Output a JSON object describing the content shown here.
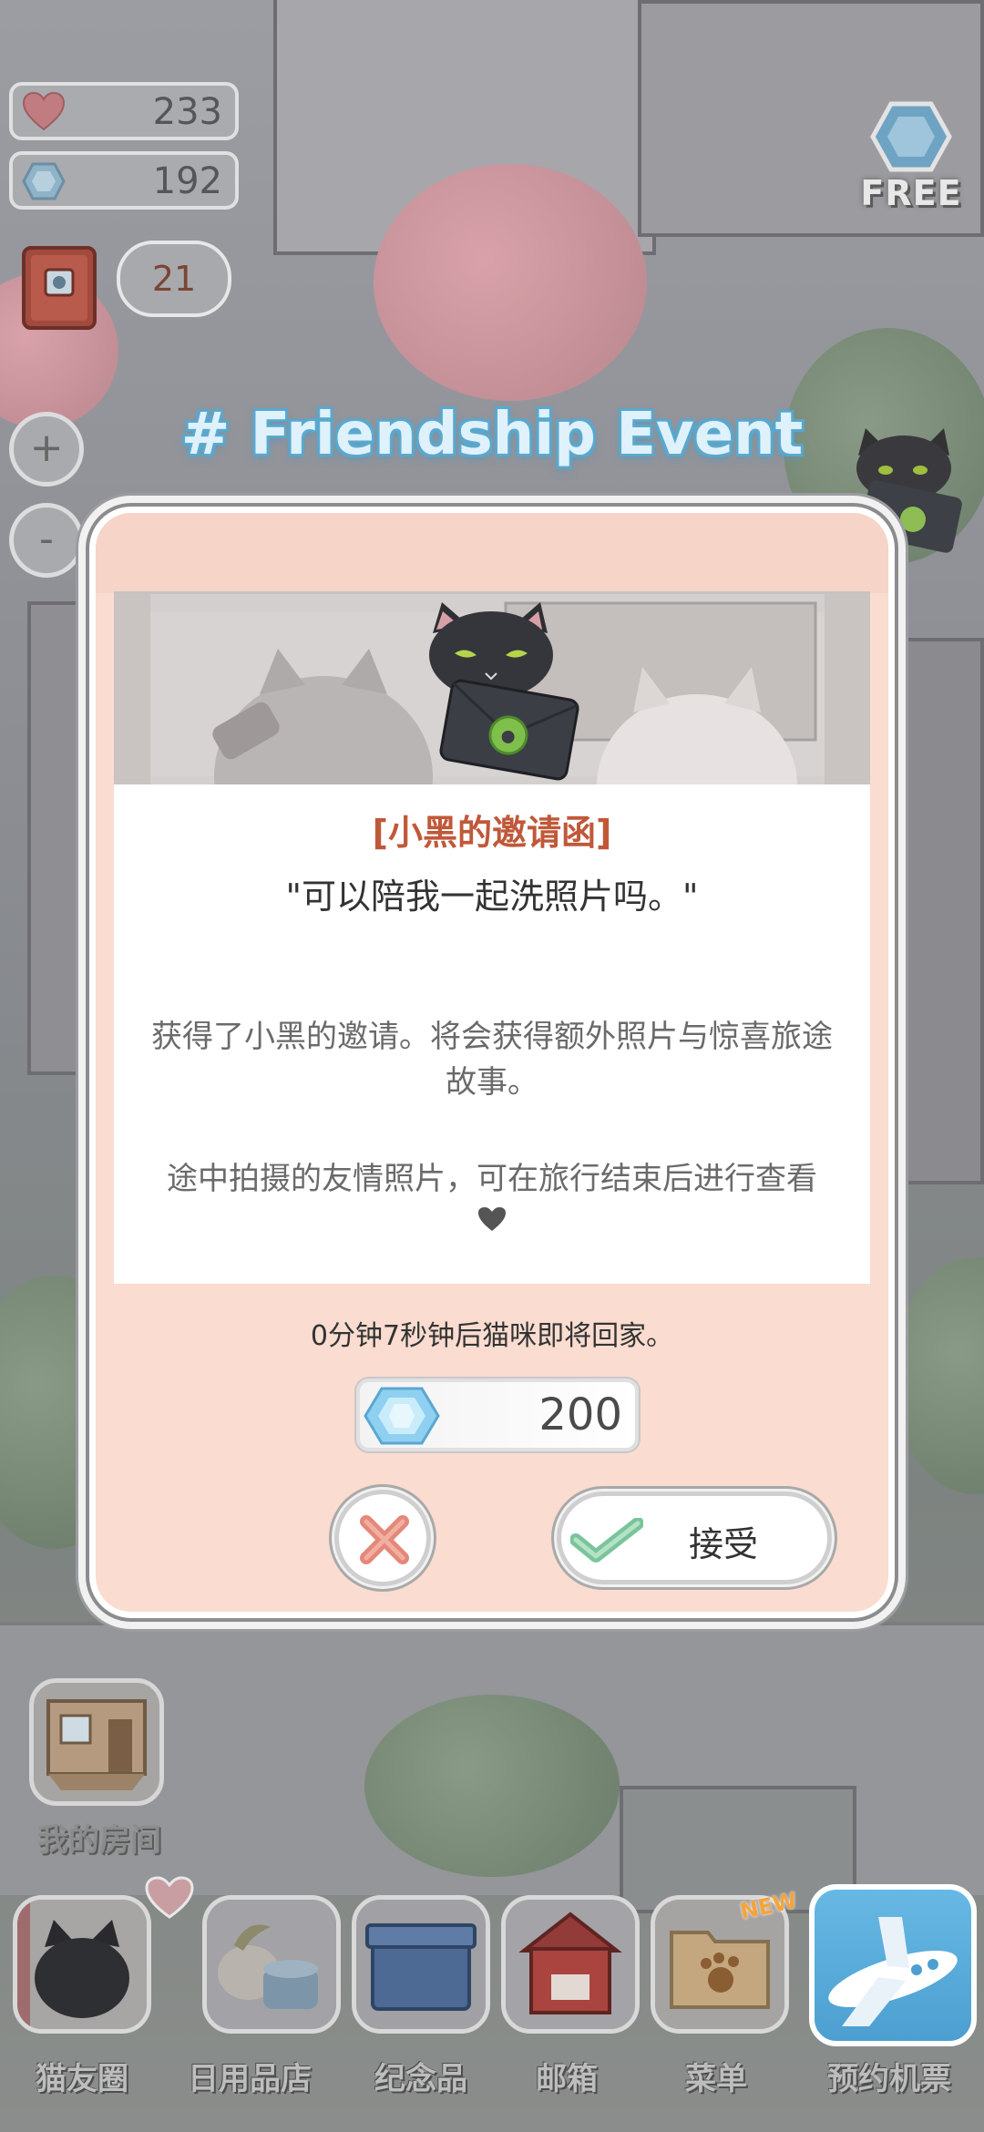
{
  "hud": {
    "hearts": "233",
    "gems": "192",
    "letters": "21",
    "zoom_in": "+",
    "zoom_out": "-",
    "free_label": "FREE"
  },
  "event": {
    "title": "# Friendship Event"
  },
  "dialog": {
    "invite_title": "[小黑的邀请函]",
    "quote": "\"可以陪我一起洗照片吗。\"",
    "description1": "获得了小黑的邀请。将会获得额外照片与惊喜旅途故事。",
    "description2": "途中拍摄的友情照片，可在旅行结束后进行查看",
    "countdown": "0分钟7秒钟后猫咪即将回家。",
    "cost": "200",
    "accept_label": "接受"
  },
  "bottom": {
    "my_room": "我的房间",
    "dock": [
      {
        "label": "猫友圈"
      },
      {
        "label": "日用品店"
      },
      {
        "label": "纪念品"
      },
      {
        "label": "邮箱"
      },
      {
        "label": "菜单"
      },
      {
        "label": "预约机票"
      }
    ],
    "new_badge": "NEW"
  },
  "colors": {
    "dialog_bg": "#fadcd0",
    "invite_title": "#c0583a",
    "event_title": "#dff1fb",
    "accept_check": "#7bc49b",
    "close_x": "#e4887a"
  }
}
